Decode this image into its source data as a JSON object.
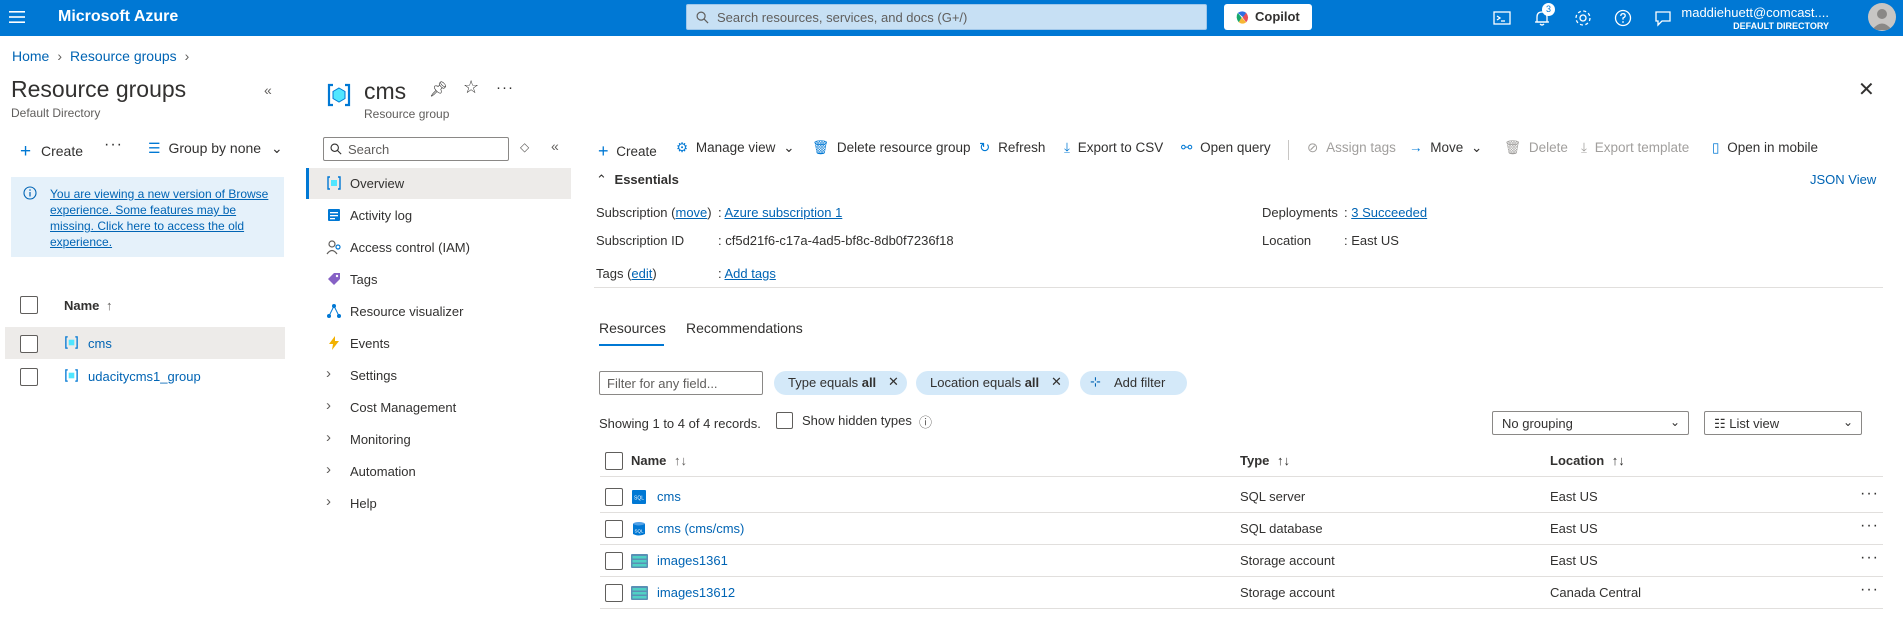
{
  "topbar": {
    "brand": "Microsoft Azure",
    "search_placeholder": "Search resources, services, and docs (G+/)",
    "copilot_label": "Copilot",
    "notification_count": "3",
    "account_email": "maddiehuett@comcast....",
    "account_directory": "DEFAULT DIRECTORY",
    "icons": [
      "cloud-shell-icon",
      "bell-icon",
      "gear-icon",
      "help-icon",
      "feedback-icon"
    ]
  },
  "breadcrumb": [
    "Home",
    "Resource groups"
  ],
  "left_pane": {
    "title": "Resource groups",
    "subtitle": "Default Directory",
    "create_label": "Create",
    "group_by_label": "Group by none",
    "info_text": "You are viewing a new version of Browse experience. Some features may be missing. Click here to access the old experience.",
    "name_header": "Name",
    "sort_arrow": "↑",
    "items": [
      {
        "name": "cms",
        "selected": true
      },
      {
        "name": "udacitycms1_group",
        "selected": false
      }
    ]
  },
  "resource": {
    "name": "cms",
    "type_label": "Resource group",
    "search_placeholder": "Search",
    "nav": [
      {
        "label": "Overview",
        "icon": "overview-icon",
        "selected": true,
        "expandable": false
      },
      {
        "label": "Activity log",
        "icon": "activity-log-icon",
        "selected": false,
        "expandable": false
      },
      {
        "label": "Access control (IAM)",
        "icon": "iam-icon",
        "selected": false,
        "expandable": false
      },
      {
        "label": "Tags",
        "icon": "tag-icon",
        "selected": false,
        "expandable": false
      },
      {
        "label": "Resource visualizer",
        "icon": "visualizer-icon",
        "selected": false,
        "expandable": false
      },
      {
        "label": "Events",
        "icon": "lightning-icon",
        "selected": false,
        "expandable": false
      },
      {
        "label": "Settings",
        "icon": "chevron-right-icon",
        "selected": false,
        "expandable": true
      },
      {
        "label": "Cost Management",
        "icon": "chevron-right-icon",
        "selected": false,
        "expandable": true
      },
      {
        "label": "Monitoring",
        "icon": "chevron-right-icon",
        "selected": false,
        "expandable": true
      },
      {
        "label": "Automation",
        "icon": "chevron-right-icon",
        "selected": false,
        "expandable": true
      },
      {
        "label": "Help",
        "icon": "chevron-right-icon",
        "selected": false,
        "expandable": true
      }
    ]
  },
  "commands": {
    "create": "Create",
    "manage_view": "Manage view",
    "delete_rg": "Delete resource group",
    "refresh": "Refresh",
    "export_csv": "Export to CSV",
    "open_query": "Open query",
    "assign_tags": "Assign tags",
    "move": "Move",
    "delete": "Delete",
    "export_template": "Export template",
    "open_mobile": "Open in mobile"
  },
  "essentials": {
    "header": "Essentials",
    "json_view": "JSON View",
    "subscription_label": "Subscription",
    "move_link": "move",
    "subscription_value": "Azure subscription 1",
    "subscription_id_label": "Subscription ID",
    "subscription_id_value": "cf5d21f6-c17a-4ad5-bf8c-8db0f7236f18",
    "tags_label": "Tags",
    "edit_link": "edit",
    "tags_value": "Add tags",
    "deployments_label": "Deployments",
    "deployments_value": "3 Succeeded",
    "location_label": "Location",
    "location_value": "East US"
  },
  "tabs": [
    "Resources",
    "Recommendations"
  ],
  "filters": {
    "placeholder": "Filter for any field...",
    "type_pill_prefix": "Type equals ",
    "type_pill_value": "all",
    "location_pill_prefix": "Location equals ",
    "location_pill_value": "all",
    "add_filter": "Add filter",
    "showing": "Showing 1 to 4 of 4 records.",
    "show_hidden": "Show hidden types",
    "grouping": "No grouping",
    "view": "List view"
  },
  "table": {
    "headers": [
      "Name",
      "Type",
      "Location"
    ],
    "rows": [
      {
        "name": "cms",
        "type": "SQL server",
        "location": "East US",
        "icon": "sql-server-icon"
      },
      {
        "name": "cms (cms/cms)",
        "type": "SQL database",
        "location": "East US",
        "icon": "sql-database-icon"
      },
      {
        "name": "images1361",
        "type": "Storage account",
        "location": "East US",
        "icon": "storage-account-icon"
      },
      {
        "name": "images13612",
        "type": "Storage account",
        "location": "Canada Central",
        "icon": "storage-account-icon"
      }
    ],
    "more_glyph": "···"
  }
}
